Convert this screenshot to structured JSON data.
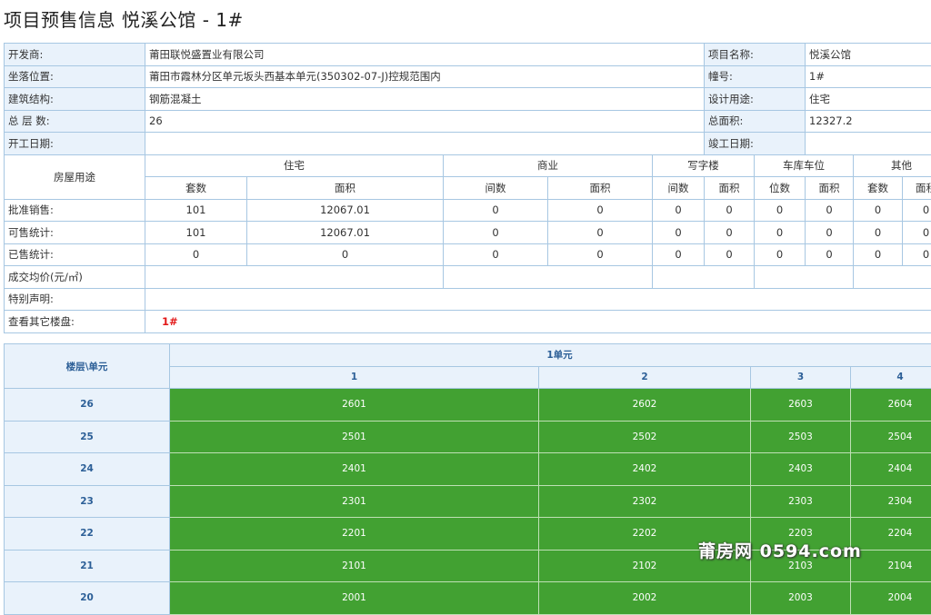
{
  "page_title": "项目预售信息 悦溪公馆 - 1#",
  "info": {
    "developer_label": "开发商:",
    "developer": "莆田联悦盛置业有限公司",
    "project_name_label": "项目名称:",
    "project_name": "悦溪公馆",
    "location_label": "坐落位置:",
    "location": "莆田市霞林分区单元坂头西基本单元(350302-07-J)控规范围内",
    "building_no_label": "幢号:",
    "building_no": "1#",
    "structure_label": "建筑结构:",
    "structure": "钢筋混凝土",
    "design_use_label": "设计用途:",
    "design_use": "住宅",
    "floors_label": "总 层 数:",
    "floors": "26",
    "total_area_label": "总面积:",
    "total_area": "12327.2",
    "start_date_label": "开工日期:",
    "start_date": "",
    "end_date_label": "竣工日期:",
    "end_date": ""
  },
  "stats": {
    "usage_label": "房屋用途",
    "groups": [
      "住宅",
      "商业",
      "写字楼",
      "车库车位",
      "其他"
    ],
    "subs": [
      "套数",
      "面积",
      "间数",
      "面积",
      "间数",
      "面积",
      "位数",
      "面积",
      "套数",
      "面积"
    ],
    "rows": [
      {
        "label": "批准销售:",
        "values": [
          "101",
          "12067.01",
          "0",
          "0",
          "0",
          "0",
          "0",
          "0",
          "0",
          "0"
        ]
      },
      {
        "label": "可售统计:",
        "values": [
          "101",
          "12067.01",
          "0",
          "0",
          "0",
          "0",
          "0",
          "0",
          "0",
          "0"
        ]
      },
      {
        "label": "已售统计:",
        "values": [
          "0",
          "0",
          "0",
          "0",
          "0",
          "0",
          "0",
          "0",
          "0",
          "0"
        ]
      }
    ],
    "avg_price_label": "成交均价(元/㎡)",
    "special_label": "特别声明:",
    "other_label": "查看其它楼盘:",
    "other_link": "1#"
  },
  "units": {
    "corner_label": "楼层\\单元",
    "unit_group": "1单元",
    "columns": [
      "1",
      "2",
      "3",
      "4"
    ],
    "floors": [
      {
        "floor": "26",
        "rooms": [
          "2601",
          "2602",
          "2603",
          "2604"
        ]
      },
      {
        "floor": "25",
        "rooms": [
          "2501",
          "2502",
          "2503",
          "2504"
        ]
      },
      {
        "floor": "24",
        "rooms": [
          "2401",
          "2402",
          "2403",
          "2404"
        ]
      },
      {
        "floor": "23",
        "rooms": [
          "2301",
          "2302",
          "2303",
          "2304"
        ]
      },
      {
        "floor": "22",
        "rooms": [
          "2201",
          "2202",
          "2203",
          "2204"
        ]
      },
      {
        "floor": "21",
        "rooms": [
          "2101",
          "2102",
          "2103",
          "2104"
        ]
      },
      {
        "floor": "20",
        "rooms": [
          "2001",
          "2002",
          "2003",
          "2004"
        ]
      }
    ],
    "available_color": "#42a132"
  },
  "watermark": "莆房网 0594.com"
}
